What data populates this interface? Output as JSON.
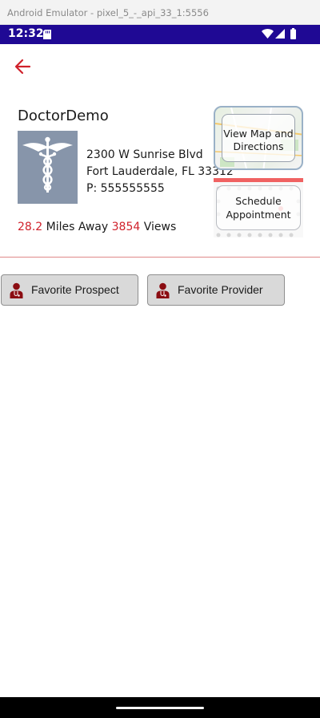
{
  "window": {
    "title": "Android Emulator - pixel_5_-_api_33_1:5556"
  },
  "status_bar": {
    "time": "12:32",
    "background": "#1f0994"
  },
  "provider": {
    "name": "DoctorDemo",
    "address_line1": "2300 W Sunrise Blvd",
    "address_line2": "Fort Lauderdale, FL   33312",
    "phone": "P: 555555555",
    "distance": "28.2",
    "distance_label": "Miles Away",
    "views": "3854",
    "views_label": "Views"
  },
  "actions": {
    "map_line1": "View Map and",
    "map_line2": "Directions",
    "schedule_line1": "Schedule",
    "schedule_line2": "Appointment",
    "favorite_prospect": "Favorite Prospect",
    "favorite_provider": "Favorite Provider"
  },
  "colors": {
    "accent": "#d0212b",
    "icon_dark_red": "#8b0d12",
    "photo_bg": "#8795aa"
  },
  "icons": {
    "back": "arrow-left-icon",
    "photo": "caduceus-icon",
    "favorite": "doctor-icon"
  }
}
